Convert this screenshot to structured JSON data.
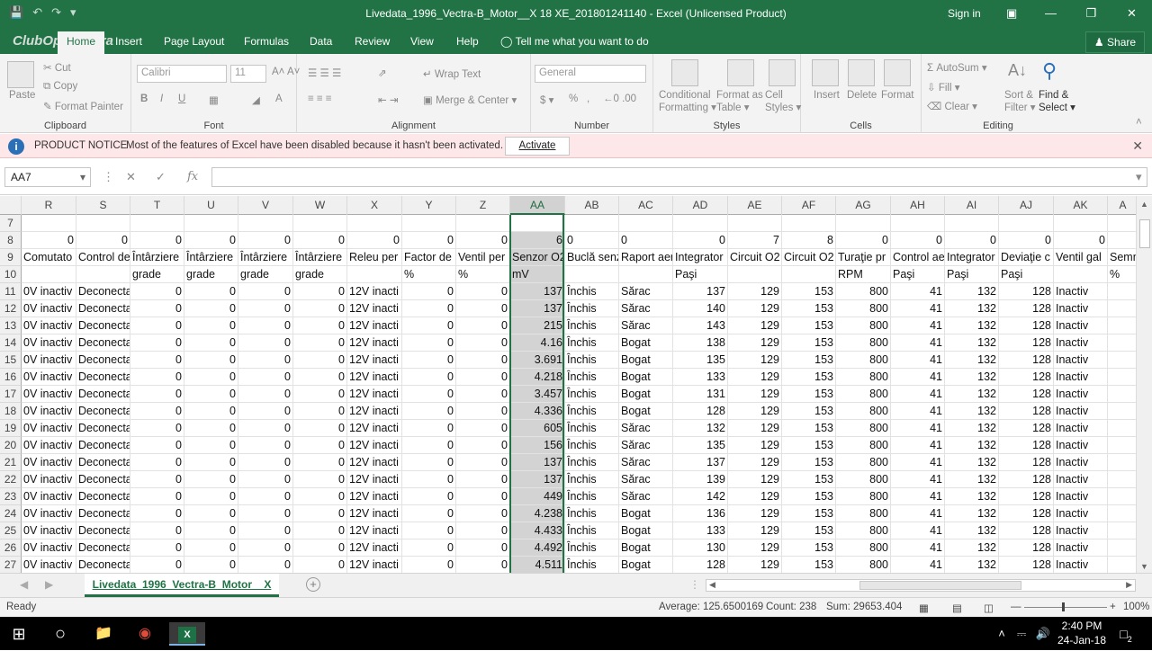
{
  "window": {
    "title": "Livedata_1996_Vectra-B_Motor__X 18 XE_201801241140  -  Excel (Unlicensed Product)",
    "sign_in": "Sign in"
  },
  "tabs": {
    "logo_text": "ClubOpelVectra",
    "home": "Home",
    "insert": "Insert",
    "page_layout": "Page Layout",
    "formulas": "Formulas",
    "data": "Data",
    "review": "Review",
    "view": "View",
    "help": "Help",
    "tell_me": "Tell me what you want to do",
    "share": "Share"
  },
  "ribbon": {
    "clipboard": {
      "label": "Clipboard",
      "paste": "Paste",
      "cut": "Cut",
      "copy": "Copy",
      "format_painter": "Format Painter"
    },
    "font": {
      "label": "Font",
      "font_name": "Calibri",
      "font_size": "11"
    },
    "alignment": {
      "label": "Alignment",
      "wrap_text": "Wrap Text",
      "merge_center": "Merge & Center"
    },
    "number": {
      "label": "Number",
      "format": "General"
    },
    "styles": {
      "label": "Styles",
      "conditional": "Conditional",
      "formatting": "Formatting",
      "format_as": "Format as",
      "table": "Table",
      "cell": "Cell",
      "cell_styles": "Styles"
    },
    "cells": {
      "label": "Cells",
      "insert": "Insert",
      "delete": "Delete",
      "format": "Format"
    },
    "editing": {
      "label": "Editing",
      "autosum": "AutoSum",
      "fill": "Fill",
      "clear": "Clear",
      "sort": "Sort &",
      "filter": "Filter",
      "find": "Find &",
      "select": "Select"
    }
  },
  "notice": {
    "title": "PRODUCT NOTICE",
    "message": "Most of the features of Excel have been disabled because it hasn't been activated.",
    "button": "Activate"
  },
  "formula_bar": {
    "name_box": "AA7",
    "value": ""
  },
  "columns": [
    "R",
    "S",
    "T",
    "U",
    "V",
    "W",
    "X",
    "Y",
    "Z",
    "AA",
    "AB",
    "AC",
    "AD",
    "AE",
    "AF",
    "AG",
    "AH",
    "AI",
    "AJ",
    "AK",
    "A"
  ],
  "rows": [
    {
      "n": "7",
      "c": [
        "",
        "",
        "",
        "",
        "",
        "",
        "",
        "",
        "",
        "",
        "",
        "",
        "",
        "",
        "",
        "",
        "",
        "",
        "",
        "",
        ""
      ]
    },
    {
      "n": "8",
      "c": [
        "0",
        "0",
        "0",
        "0",
        "0",
        "0",
        "0",
        "0",
        "0",
        "6",
        "0",
        "0",
        "0",
        "7",
        "8",
        "0",
        "0",
        "0",
        "0",
        "0",
        ""
      ]
    },
    {
      "n": "9",
      "c": [
        "Comutato",
        "Control de",
        "Întârziere",
        "Întârziere",
        "Întârziere",
        "Întârziere",
        "Releu per",
        "Factor de",
        "Ventil per",
        "Senzor O2",
        "Buclă senz",
        "Raport aer",
        "Integrator",
        "Circuit O2",
        "Circuit O2",
        "Turaţie pr",
        "Control ae",
        "Integrator",
        "Deviaţie c",
        "Ventil gal",
        "Semn"
      ]
    },
    {
      "n": "10",
      "c": [
        "",
        "",
        "grade",
        "grade",
        "grade",
        "grade",
        "",
        "%",
        "%",
        "mV",
        "",
        "",
        "Paşi",
        "",
        "",
        "RPM",
        "Paşi",
        "Paşi",
        "Paşi",
        "",
        "%"
      ]
    },
    {
      "n": "11",
      "c": [
        "0V inactiv",
        "Deconecta",
        "0",
        "0",
        "0",
        "0",
        "12V inacti",
        "0",
        "0",
        "137",
        "Închis",
        "Sărac",
        "137",
        "129",
        "153",
        "800",
        "41",
        "132",
        "128",
        "Inactiv",
        ""
      ]
    },
    {
      "n": "12",
      "c": [
        "0V inactiv",
        "Deconecta",
        "0",
        "0",
        "0",
        "0",
        "12V inacti",
        "0",
        "0",
        "137",
        "Închis",
        "Sărac",
        "140",
        "129",
        "153",
        "800",
        "41",
        "132",
        "128",
        "Inactiv",
        ""
      ]
    },
    {
      "n": "13",
      "c": [
        "0V inactiv",
        "Deconecta",
        "0",
        "0",
        "0",
        "0",
        "12V inacti",
        "0",
        "0",
        "215",
        "Închis",
        "Sărac",
        "143",
        "129",
        "153",
        "800",
        "41",
        "132",
        "128",
        "Inactiv",
        ""
      ]
    },
    {
      "n": "14",
      "c": [
        "0V inactiv",
        "Deconecta",
        "0",
        "0",
        "0",
        "0",
        "12V inacti",
        "0",
        "0",
        "4.16",
        "Închis",
        "Bogat",
        "138",
        "129",
        "153",
        "800",
        "41",
        "132",
        "128",
        "Inactiv",
        ""
      ]
    },
    {
      "n": "15",
      "c": [
        "0V inactiv",
        "Deconecta",
        "0",
        "0",
        "0",
        "0",
        "12V inacti",
        "0",
        "0",
        "3.691",
        "Închis",
        "Bogat",
        "135",
        "129",
        "153",
        "800",
        "41",
        "132",
        "128",
        "Inactiv",
        ""
      ]
    },
    {
      "n": "16",
      "c": [
        "0V inactiv",
        "Deconecta",
        "0",
        "0",
        "0",
        "0",
        "12V inacti",
        "0",
        "0",
        "4.218",
        "Închis",
        "Bogat",
        "133",
        "129",
        "153",
        "800",
        "41",
        "132",
        "128",
        "Inactiv",
        ""
      ]
    },
    {
      "n": "17",
      "c": [
        "0V inactiv",
        "Deconecta",
        "0",
        "0",
        "0",
        "0",
        "12V inacti",
        "0",
        "0",
        "3.457",
        "Închis",
        "Bogat",
        "131",
        "129",
        "153",
        "800",
        "41",
        "132",
        "128",
        "Inactiv",
        ""
      ]
    },
    {
      "n": "18",
      "c": [
        "0V inactiv",
        "Deconecta",
        "0",
        "0",
        "0",
        "0",
        "12V inacti",
        "0",
        "0",
        "4.336",
        "Închis",
        "Bogat",
        "128",
        "129",
        "153",
        "800",
        "41",
        "132",
        "128",
        "Inactiv",
        ""
      ]
    },
    {
      "n": "19",
      "c": [
        "0V inactiv",
        "Deconecta",
        "0",
        "0",
        "0",
        "0",
        "12V inacti",
        "0",
        "0",
        "605",
        "Închis",
        "Sărac",
        "132",
        "129",
        "153",
        "800",
        "41",
        "132",
        "128",
        "Inactiv",
        ""
      ]
    },
    {
      "n": "20",
      "c": [
        "0V inactiv",
        "Deconecta",
        "0",
        "0",
        "0",
        "0",
        "12V inacti",
        "0",
        "0",
        "156",
        "Închis",
        "Sărac",
        "135",
        "129",
        "153",
        "800",
        "41",
        "132",
        "128",
        "Inactiv",
        ""
      ]
    },
    {
      "n": "21",
      "c": [
        "0V inactiv",
        "Deconecta",
        "0",
        "0",
        "0",
        "0",
        "12V inacti",
        "0",
        "0",
        "137",
        "Închis",
        "Sărac",
        "137",
        "129",
        "153",
        "800",
        "41",
        "132",
        "128",
        "Inactiv",
        ""
      ]
    },
    {
      "n": "22",
      "c": [
        "0V inactiv",
        "Deconecta",
        "0",
        "0",
        "0",
        "0",
        "12V inacti",
        "0",
        "0",
        "137",
        "Închis",
        "Sărac",
        "139",
        "129",
        "153",
        "800",
        "41",
        "132",
        "128",
        "Inactiv",
        ""
      ]
    },
    {
      "n": "23",
      "c": [
        "0V inactiv",
        "Deconecta",
        "0",
        "0",
        "0",
        "0",
        "12V inacti",
        "0",
        "0",
        "449",
        "Închis",
        "Sărac",
        "142",
        "129",
        "153",
        "800",
        "41",
        "132",
        "128",
        "Inactiv",
        ""
      ]
    },
    {
      "n": "24",
      "c": [
        "0V inactiv",
        "Deconecta",
        "0",
        "0",
        "0",
        "0",
        "12V inacti",
        "0",
        "0",
        "4.238",
        "Închis",
        "Bogat",
        "136",
        "129",
        "153",
        "800",
        "41",
        "132",
        "128",
        "Inactiv",
        ""
      ]
    },
    {
      "n": "25",
      "c": [
        "0V inactiv",
        "Deconecta",
        "0",
        "0",
        "0",
        "0",
        "12V inacti",
        "0",
        "0",
        "4.433",
        "Închis",
        "Bogat",
        "133",
        "129",
        "153",
        "800",
        "41",
        "132",
        "128",
        "Inactiv",
        ""
      ]
    },
    {
      "n": "26",
      "c": [
        "0V inactiv",
        "Deconecta",
        "0",
        "0",
        "0",
        "0",
        "12V inacti",
        "0",
        "0",
        "4.492",
        "Închis",
        "Bogat",
        "130",
        "129",
        "153",
        "800",
        "41",
        "132",
        "128",
        "Inactiv",
        ""
      ]
    },
    {
      "n": "27",
      "c": [
        "0V inactiv",
        "Deconecta",
        "0",
        "0",
        "0",
        "0",
        "12V inacti",
        "0",
        "0",
        "4.511",
        "Închis",
        "Bogat",
        "128",
        "129",
        "153",
        "800",
        "41",
        "132",
        "128",
        "Inactiv",
        ""
      ]
    }
  ],
  "sheet_tab": "Livedata_1996_Vectra-B_Motor__X",
  "status": {
    "ready": "Ready",
    "average": "Average: 125.6500169",
    "count": "Count: 238",
    "sum": "Sum: 29653.404",
    "zoom": "100%"
  },
  "taskbar": {
    "time": "2:40 PM",
    "date": "24-Jan-18",
    "notifications": "2"
  }
}
